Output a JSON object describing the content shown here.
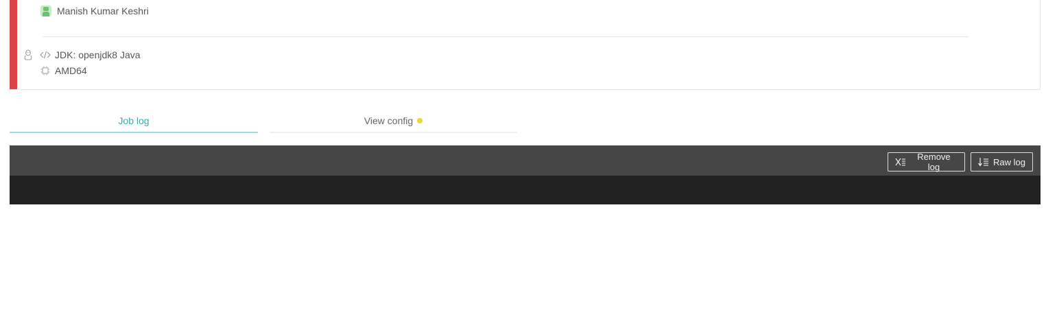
{
  "job": {
    "author": "Manish Kumar Keshri",
    "language": "JDK: openjdk8 Java",
    "arch": "AMD64",
    "status_color": "#db4545",
    "icons": {
      "os": "linux-tux-icon",
      "language": "code-icon",
      "arch": "cpu-chip-icon",
      "avatar": "user-avatar-icon"
    }
  },
  "tabs": {
    "job_log": "Job log",
    "view_config": "View config",
    "config_indicator_color": "#e8d83a"
  },
  "log_toolbar": {
    "remove_log": "Remove log",
    "raw_log": "Raw log"
  },
  "colors": {
    "accent": "#3eaaaf",
    "toolbar_bg": "#464646",
    "log_bg": "#222222"
  }
}
